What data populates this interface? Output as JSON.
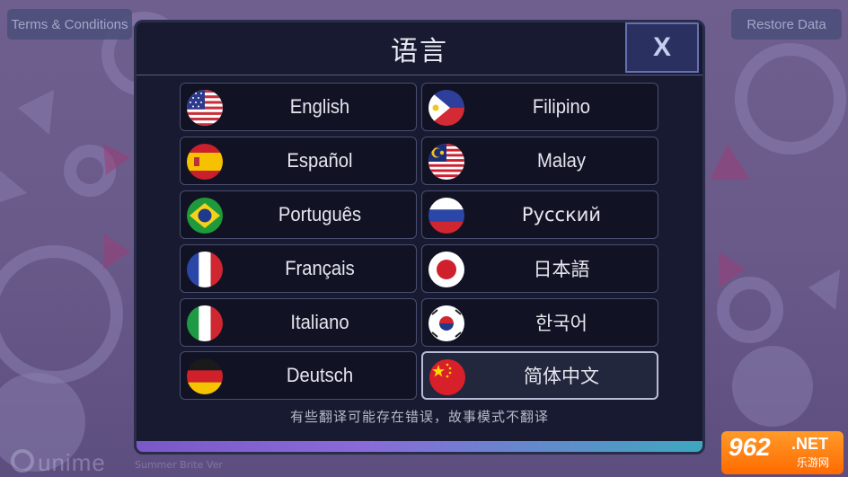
{
  "app": {
    "terms_label": "Terms & Conditions",
    "restore_label": "Restore Data",
    "brand": "unime",
    "brand_sub": "Summer Brite Ver"
  },
  "dialog": {
    "title": "语言",
    "close_label": "X",
    "footnote": "有些翻译可能存在错误，故事模式不翻译",
    "progress": 1.0,
    "languages": [
      {
        "label": "English",
        "flag": "us-flag-icon"
      },
      {
        "label": "Filipino",
        "flag": "ph-flag-icon"
      },
      {
        "label": "Español",
        "flag": "es-flag-icon"
      },
      {
        "label": "Malay",
        "flag": "my-flag-icon"
      },
      {
        "label": "Português",
        "flag": "br-flag-icon"
      },
      {
        "label": "Русский",
        "flag": "ru-flag-icon"
      },
      {
        "label": "Français",
        "flag": "fr-flag-icon"
      },
      {
        "label": "日本語",
        "flag": "jp-flag-icon"
      },
      {
        "label": "Italiano",
        "flag": "it-flag-icon"
      },
      {
        "label": "한국어",
        "flag": "kr-flag-icon"
      },
      {
        "label": "Deutsch",
        "flag": "de-flag-icon"
      },
      {
        "label": "简体中文",
        "flag": "cn-flag-icon",
        "selected": true
      }
    ]
  },
  "watermark": {
    "number": "962",
    "suffix": ".NET",
    "sub": "乐游网"
  }
}
